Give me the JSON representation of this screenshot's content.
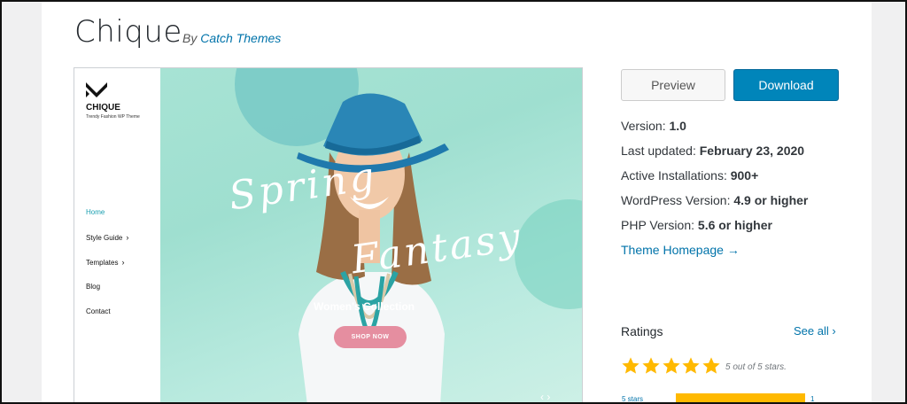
{
  "theme": {
    "name": "Chique",
    "by_prefix": "By",
    "author": "Catch Themes"
  },
  "screenshot": {
    "logo_text": "CHIQUE",
    "logo_tagline": "Trendy Fashion WP Theme",
    "nav": [
      {
        "label": "Home",
        "active": true,
        "has_submenu": false
      },
      {
        "label": "Style Guide",
        "active": false,
        "has_submenu": true
      },
      {
        "label": "Templates",
        "active": false,
        "has_submenu": true
      },
      {
        "label": "Blog",
        "active": false,
        "has_submenu": false
      },
      {
        "label": "Contact",
        "active": false,
        "has_submenu": false
      }
    ],
    "hero_title_line1": "Spring",
    "hero_title_line2": "Fantasy",
    "hero_subtitle": "Women's Collection",
    "hero_button": "SHOP NOW",
    "slider_arrows": "‹ ›"
  },
  "actions": {
    "preview_label": "Preview",
    "download_label": "Download"
  },
  "meta": {
    "version_label": "Version:",
    "version_value": "1.0",
    "updated_label": "Last updated:",
    "updated_value": "February 23, 2020",
    "installs_label": "Active Installations:",
    "installs_value": "900+",
    "wp_label": "WordPress Version:",
    "wp_value": "4.9 or higher",
    "php_label": "PHP Version:",
    "php_value": "5.6 or higher",
    "homepage_link": "Theme Homepage →"
  },
  "ratings": {
    "title": "Ratings",
    "see_all": "See all",
    "stars_label": "5 out of 5 stars.",
    "star_count": 5,
    "rating": 5,
    "bar_label": "5 stars",
    "bar_count": "1",
    "bar_fraction": 1.0
  },
  "colors": {
    "link": "#0073aa",
    "download_button": "#0085ba",
    "star": "#ffb900",
    "hero_bg": "#a7e3d4",
    "shop_button": "#e58ea0",
    "nav_active": "#1a9fb0"
  }
}
